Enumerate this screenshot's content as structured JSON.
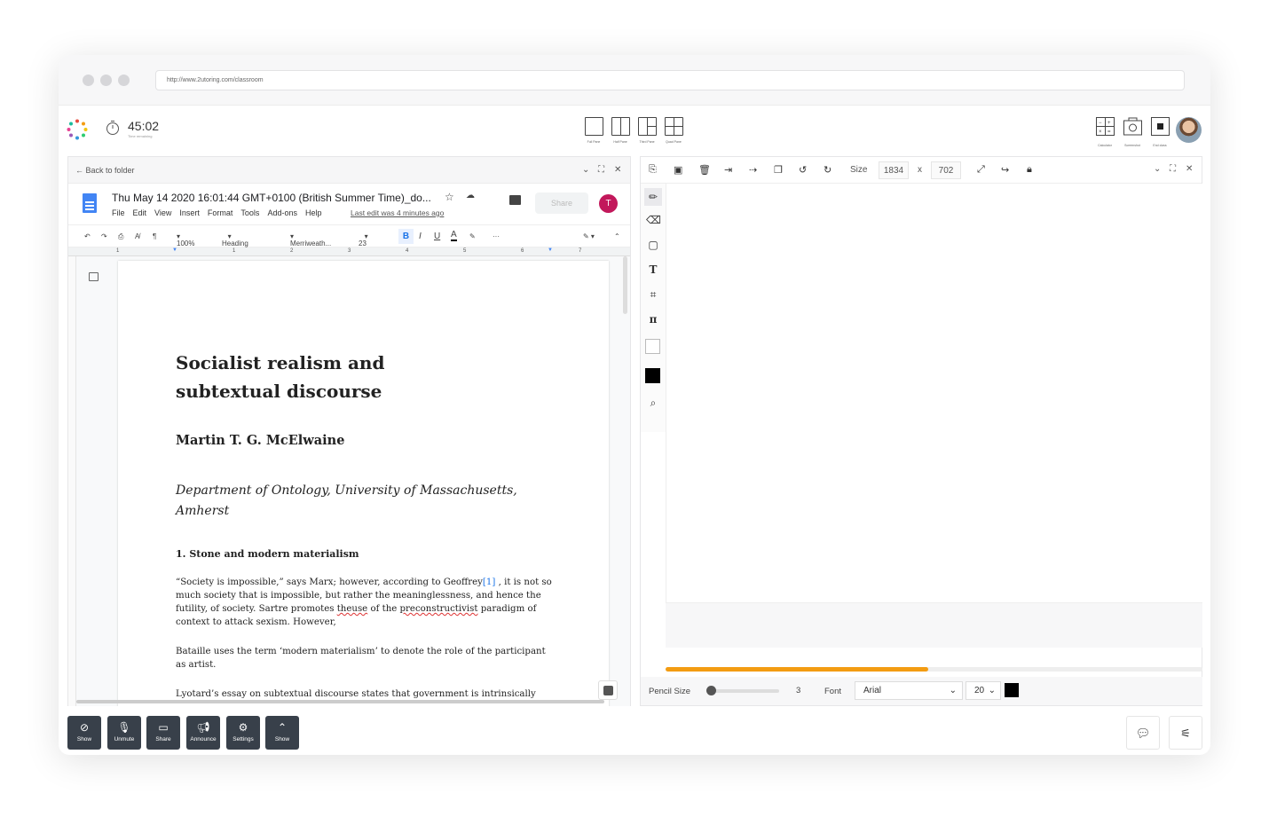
{
  "browser": {
    "url": "http://www.2utoring.com/classroom"
  },
  "session": {
    "timer": "45:02",
    "timer_sub": "Time remaining"
  },
  "layout_modes": [
    "Full Pane",
    "Half Pane",
    "Third Pane",
    "Quad Pane"
  ],
  "tools": [
    "Calculator",
    "Screenshot",
    "End class"
  ],
  "left_panel": {
    "back": "Back to folder",
    "doc_title": "Thu May 14 2020 16:01:44 GMT+0100 (British Summer Time)_do...",
    "menu": [
      "File",
      "Edit",
      "View",
      "Insert",
      "Format",
      "Tools",
      "Add-ons",
      "Help"
    ],
    "last_edit": "Last edit was 4 minutes ago",
    "share": "Share",
    "user_initial": "T",
    "toolbar": {
      "zoom": "100%",
      "style": "Heading 1",
      "font": "Merriweath...",
      "size": "23",
      "bold": "B",
      "italic": "I",
      "underline": "U",
      "color": "A",
      "more": "···"
    },
    "ruler": [
      "1",
      "1",
      "2",
      "3",
      "4",
      "5",
      "6",
      "7"
    ],
    "document": {
      "title": "Socialist realism and subtextual discourse",
      "author": "Martin T. G. McElwaine",
      "dept": "Department of Ontology, University of Massachusetts, Amherst",
      "section": "1. Stone and modern materialism",
      "p1_a": "“Society is impossible,” says Marx; however, according to Geoffrey",
      "p1_cite": "[1]",
      "p1_b": " , it is not so much society that is impossible, but rather the meaninglessness, and hence the futility, of society. Sartre promotes ",
      "p1_err1": "theuse",
      "p1_c": " of the ",
      "p1_err2": "preconstructivist",
      "p1_d": " paradigm of context to attack sexism. However,",
      "p2": "Bataille uses the term ‘modern materialism’ to denote the role of the participant as artist.",
      "p3": "Lyotard’s essay on subtextual discourse states that government is intrinsically"
    }
  },
  "right_panel": {
    "size_label": "Size",
    "width": "1834",
    "x": "x",
    "height": "702",
    "progress": 0.49,
    "pencil_label": "Pencil Size",
    "pencil_value": "3",
    "font_label": "Font",
    "font_value": "Arial",
    "font_size": "20",
    "color": "#000000"
  },
  "bottom_bar": [
    "Show",
    "Unmute",
    "Share",
    "Announce",
    "Settings",
    "Show"
  ]
}
